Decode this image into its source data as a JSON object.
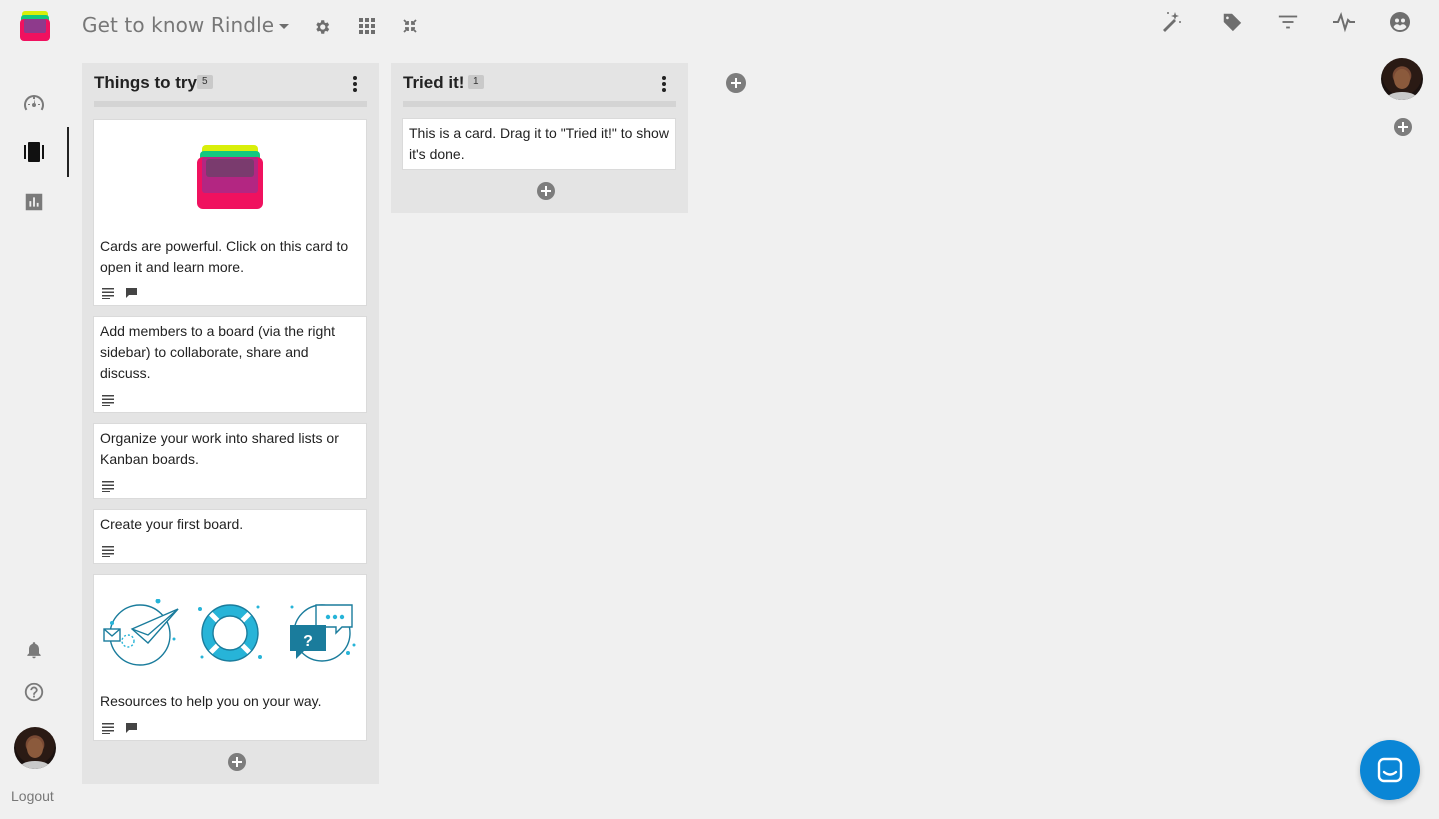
{
  "header": {
    "board_title": "Get to know Rindle",
    "icons": [
      "board-dropdown-icon",
      "settings-icon",
      "apps-grid-icon",
      "collapse-icon",
      "magic-wand-icon",
      "tag-icon",
      "filter-icon",
      "activity-icon",
      "board-members-icon"
    ]
  },
  "nav": {
    "items": [
      "dashboard-icon",
      "boards-icon",
      "reports-icon"
    ],
    "bottom": [
      "notifications-icon",
      "help-icon"
    ],
    "logout_label": "Logout"
  },
  "lists": [
    {
      "title": "Things to try",
      "count": "5",
      "cards": [
        {
          "text": "Cards are powerful. Click on this card to open it and learn more.",
          "badges": [
            "description-icon",
            "comments-icon"
          ],
          "image": "rindle-logo"
        },
        {
          "text": "Add members to a board (via the right sidebar) to collaborate, share and discuss.",
          "badges": [
            "description-icon"
          ]
        },
        {
          "text": "Organize your work into shared lists or Kanban boards.",
          "badges": [
            "description-icon"
          ]
        },
        {
          "text": "Create your first board.",
          "badges": [
            "description-icon"
          ]
        },
        {
          "text": "Resources to help you on your way.",
          "badges": [
            "description-icon",
            "comments-icon"
          ],
          "image": "resources-illustrations"
        }
      ]
    },
    {
      "title": "Tried it!",
      "count": "1",
      "cards": [
        {
          "text": "This is a card. Drag it to \"Tried it!\" to show it's done.",
          "badges": []
        }
      ]
    }
  ],
  "colors": {
    "background": "#f0f0f0",
    "list_background": "#e4e4e4",
    "chat_button": "#0a86d6",
    "logo_pink": "#f0115f",
    "logo_purple": "#8e3a8c",
    "logo_green": "#12c87f",
    "logo_yellow": "#d9ef0a",
    "illustration_teal": "#1a7c9c",
    "illustration_cyan": "#27b4d8"
  }
}
